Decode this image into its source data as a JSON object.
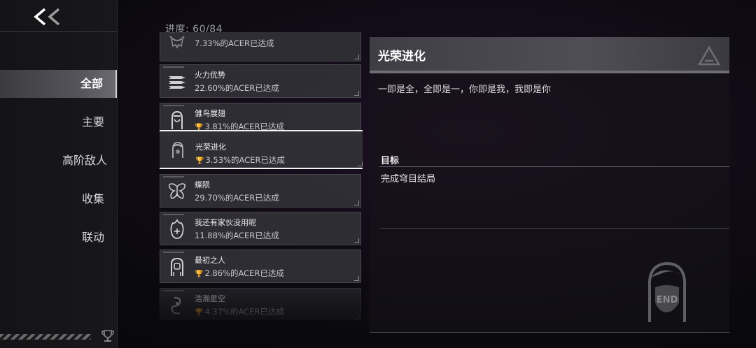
{
  "sidebar": {
    "back_label": "<<",
    "items": [
      {
        "label": "全部",
        "active": true
      },
      {
        "label": "主要",
        "active": false
      },
      {
        "label": "高阶敌人",
        "active": false
      },
      {
        "label": "收集",
        "active": false
      },
      {
        "label": "联动",
        "active": false
      }
    ]
  },
  "progress": "进度: 60/84",
  "achievements": [
    {
      "name": "",
      "percent": "7.33%的ACER已达成",
      "icon": "faded-emblem-icon",
      "trophy": false
    },
    {
      "name": "火力优势",
      "percent": "22.60%的ACER已达成",
      "icon": "missiles-icon",
      "trophy": false
    },
    {
      "name": "雏鸟展翅",
      "percent": "3.81%的ACER已达成",
      "icon": "helmet-girl-icon",
      "trophy": true
    },
    {
      "name": "光荣进化",
      "percent": "3.53%的ACER已达成",
      "icon": "head-portrait-icon",
      "trophy": true
    },
    {
      "name": "蝶陨",
      "percent": "29.70%的ACER已达成",
      "icon": "butterfly-icon",
      "trophy": false
    },
    {
      "name": "我还有家伙没用呢",
      "percent": "11.88%的ACER已达成",
      "icon": "burning-emblem-icon",
      "trophy": false
    },
    {
      "name": "最初之人",
      "percent": "2.86%的ACER已达成",
      "icon": "long-hair-portrait-icon",
      "trophy": true
    },
    {
      "name": "浩瀚星空",
      "percent": "4.37%的ACER已达成",
      "icon": "swirl-symbol-icon",
      "trophy": true
    }
  ],
  "detail": {
    "title": "光荣进化",
    "description": "一即是全，全即是一，你即是我，我即是你",
    "goal_label": "目标",
    "goal_text": "完成穹目结局",
    "badge_text": "END"
  },
  "colors": {
    "panel_header": "#4a4a50",
    "selected_border": "#f2f2f2",
    "background": "#0a090d"
  }
}
